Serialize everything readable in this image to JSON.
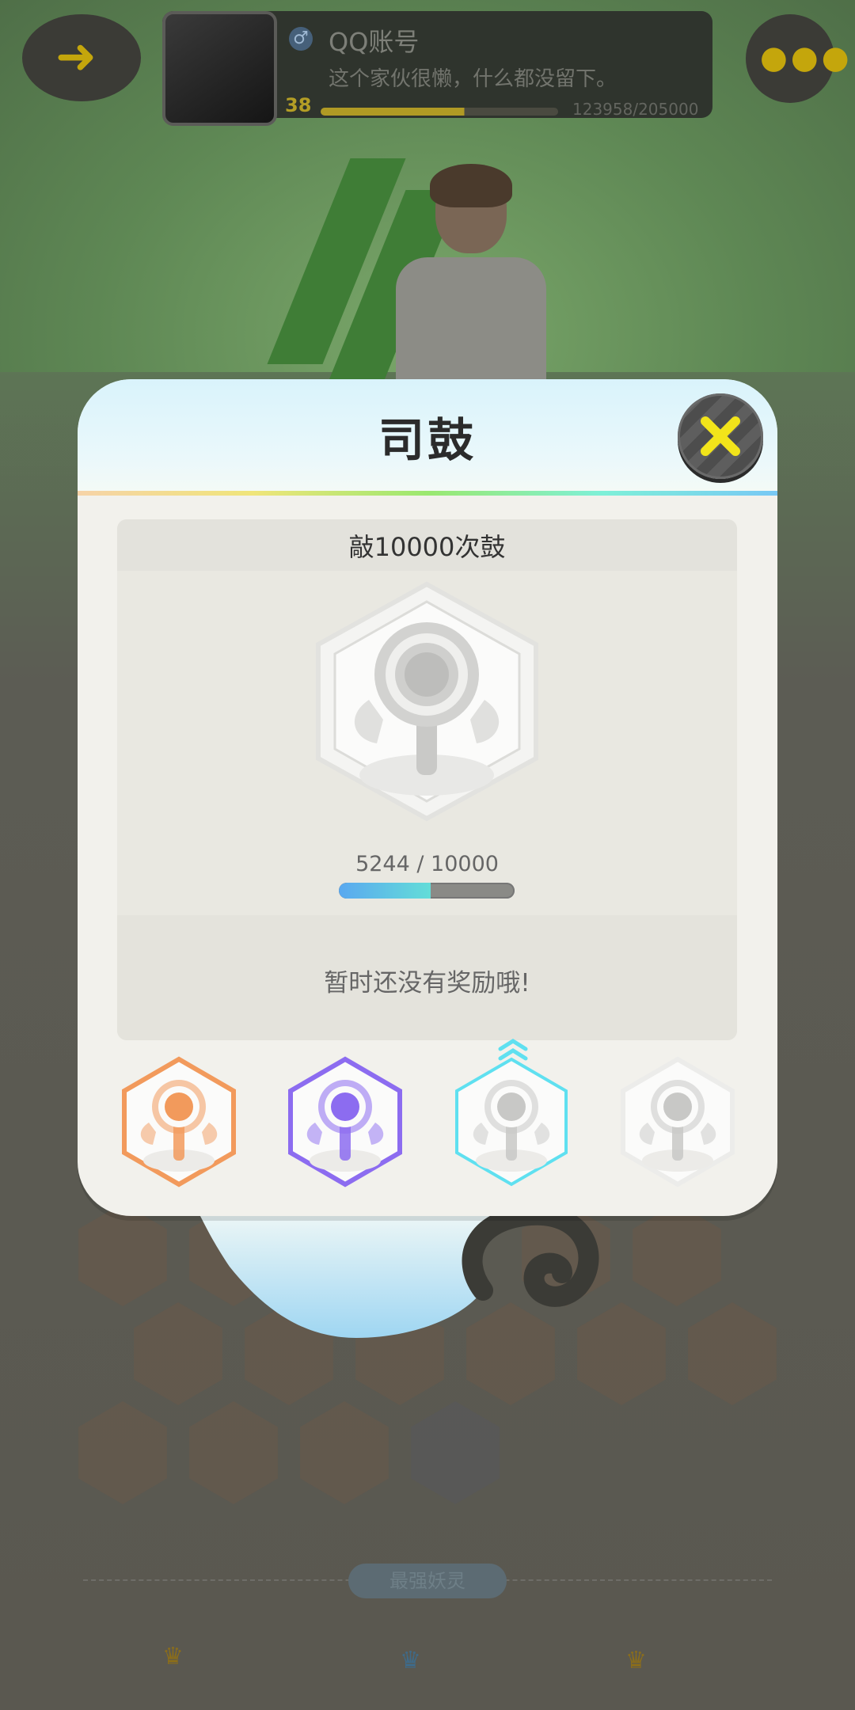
{
  "background": {
    "profile": {
      "name": "QQ账号",
      "signature": "这个家伙很懒，什么都没留下。",
      "level": "38",
      "exp": "123958/205000",
      "exp_fraction": 0.6047,
      "gender_symbol": "♂"
    },
    "section_label": "最强妖灵",
    "back_icon": "arrow-left-icon",
    "more_icon": "more-dots-icon"
  },
  "modal": {
    "title": "司鼓",
    "task": "敲10000次鼓",
    "progress": {
      "current": 5244,
      "total": 10000,
      "text": "5244 / 10000"
    },
    "reward_text": "暂时还没有奖励哦!",
    "tiers": [
      {
        "name": "bronze",
        "color": "#f29a5c",
        "selected": false
      },
      {
        "name": "purple",
        "color": "#8c6cf0",
        "selected": false
      },
      {
        "name": "silver",
        "color": "#5fe0f0",
        "selected": true
      },
      {
        "name": "gray",
        "color": "#d0d0d0",
        "selected": false
      }
    ],
    "close_icon": "close-icon"
  }
}
